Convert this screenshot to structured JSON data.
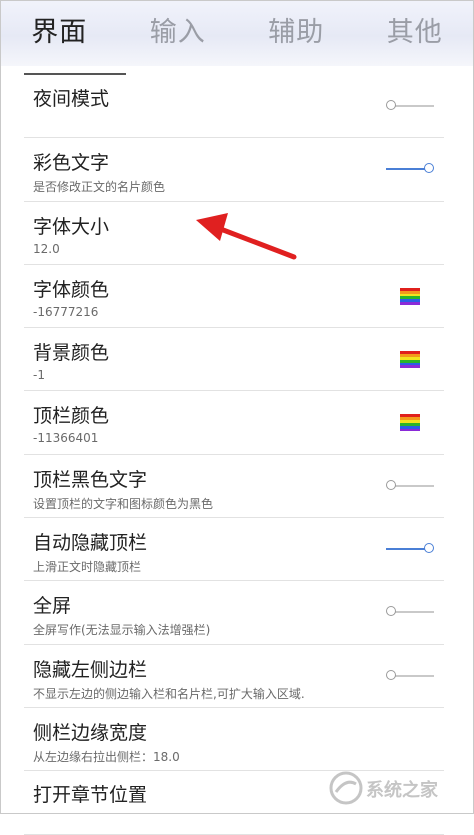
{
  "tabs": [
    {
      "label": "界面",
      "active": true
    },
    {
      "label": "输入",
      "active": false
    },
    {
      "label": "辅助",
      "active": false
    },
    {
      "label": "其他",
      "active": false
    }
  ],
  "settings": [
    {
      "title": "夜间模式",
      "subtitle": "",
      "control": "toggle",
      "on": false
    },
    {
      "title": "彩色文字",
      "subtitle": "是否修改正文的名片颜色",
      "control": "toggle",
      "on": true
    },
    {
      "title": "字体大小",
      "subtitle": "12.0",
      "control": "none"
    },
    {
      "title": "字体颜色",
      "subtitle": "-16777216",
      "control": "swatch"
    },
    {
      "title": "背景颜色",
      "subtitle": "-1",
      "control": "swatch"
    },
    {
      "title": "顶栏颜色",
      "subtitle": "-11366401",
      "control": "swatch"
    },
    {
      "title": "顶栏黑色文字",
      "subtitle": "设置顶栏的文字和图标颜色为黑色",
      "control": "toggle",
      "on": false
    },
    {
      "title": "自动隐藏顶栏",
      "subtitle": "上滑正文时隐藏顶栏",
      "control": "toggle",
      "on": true
    },
    {
      "title": "全屏",
      "subtitle": "全屏写作(无法显示输入法增强栏)",
      "control": "toggle",
      "on": false
    },
    {
      "title": "隐藏左侧边栏",
      "subtitle": "不显示左边的侧边输入栏和名片栏,可扩大输入区域.",
      "control": "toggle",
      "on": false
    },
    {
      "title": "侧栏边缘宽度",
      "subtitle": "从左边缘右拉出侧栏：18.0",
      "control": "none"
    },
    {
      "title": "打开章节位置",
      "subtitle": "",
      "control": "none"
    }
  ],
  "colors": {
    "accent": "#4a7fd6",
    "annotation_arrow": "#e02020",
    "rainbow": [
      "#e0201c",
      "#f39a1c",
      "#f2e51e",
      "#2ab42a",
      "#2a5ee6",
      "#8a2ad8"
    ]
  },
  "annotation": {
    "type": "arrow-icon"
  },
  "watermark": {
    "text": "系统之家"
  }
}
